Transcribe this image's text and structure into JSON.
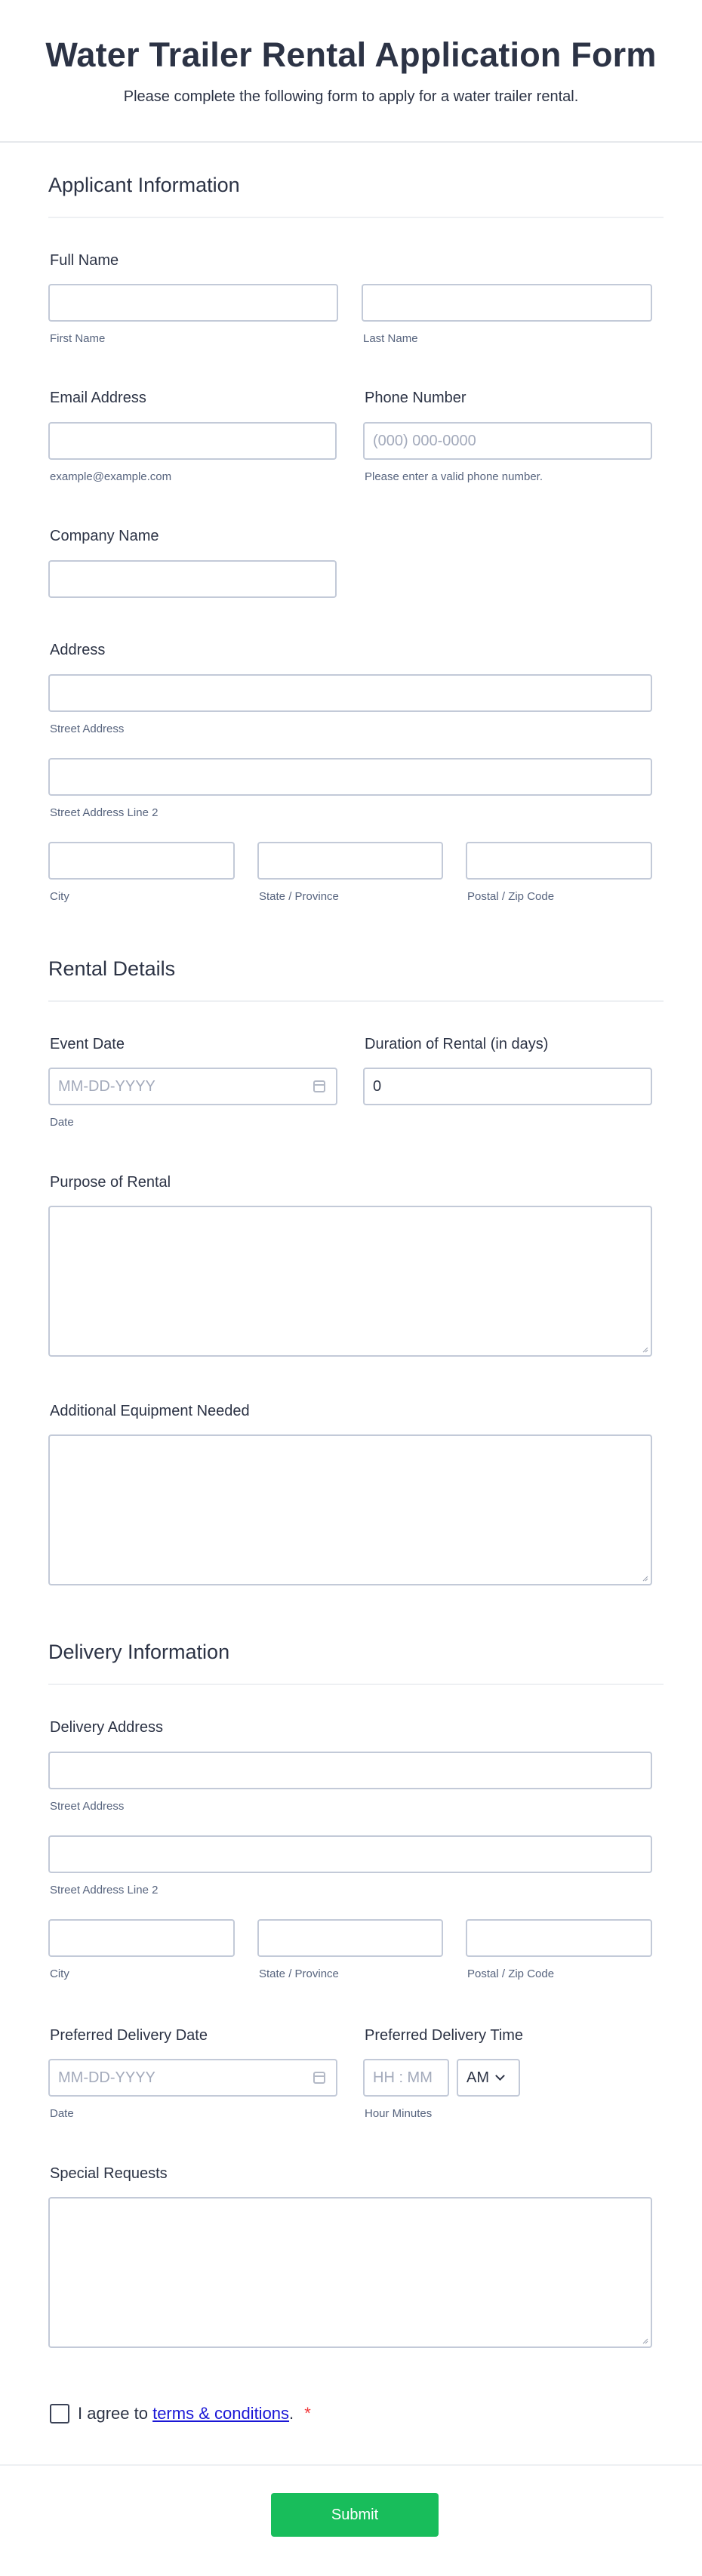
{
  "header": {
    "title": "Water Trailer Rental Application Form",
    "subtitle": "Please complete the following form to apply for a water trailer rental."
  },
  "applicant": {
    "section_title": "Applicant Information",
    "full_name_label": "Full Name",
    "first_name_sublabel": "First Name",
    "last_name_sublabel": "Last Name",
    "email_label": "Email Address",
    "email_sublabel": "example@example.com",
    "phone_label": "Phone Number",
    "phone_placeholder": "(000) 000-0000",
    "phone_sublabel": "Please enter a valid phone number.",
    "company_label": "Company Name",
    "address_label": "Address",
    "street_sublabel": "Street Address",
    "street2_sublabel": "Street Address Line 2",
    "city_sublabel": "City",
    "state_sublabel": "State / Province",
    "zip_sublabel": "Postal / Zip Code"
  },
  "rental": {
    "section_title": "Rental Details",
    "event_date_label": "Event Date",
    "event_date_placeholder": "MM-DD-YYYY",
    "event_date_sublabel": "Date",
    "duration_label": "Duration of Rental (in days)",
    "duration_value": "0",
    "purpose_label": "Purpose of Rental",
    "equipment_label": "Additional Equipment Needed"
  },
  "delivery": {
    "section_title": "Delivery Information",
    "address_label": "Delivery Address",
    "street_sublabel": "Street Address",
    "street2_sublabel": "Street Address Line 2",
    "city_sublabel": "City",
    "state_sublabel": "State / Province",
    "zip_sublabel": "Postal / Zip Code",
    "date_label": "Preferred Delivery Date",
    "date_placeholder": "MM-DD-YYYY",
    "date_sublabel": "Date",
    "time_label": "Preferred Delivery Time",
    "time_placeholder": "HH : MM",
    "ampm_value": "AM",
    "time_sublabel": "Hour Minutes",
    "special_label": "Special Requests"
  },
  "terms": {
    "prefix": "I agree to ",
    "link_text": "terms & conditions",
    "suffix": ".",
    "required_mark": "*"
  },
  "submit_label": "Submit"
}
